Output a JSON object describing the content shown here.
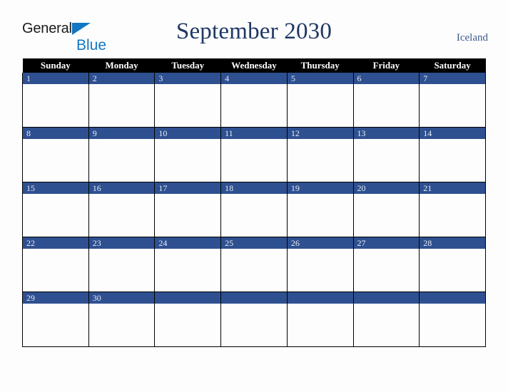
{
  "brand": {
    "line1": "General",
    "line2": "Blue",
    "triangle_icon": "triangle-icon",
    "color_dark": "#1a1a1a",
    "color_blue": "#1277c4"
  },
  "header": {
    "title": "September 2030",
    "country": "Iceland",
    "title_color": "#1f3864",
    "country_color": "#3d5a8a"
  },
  "calendar": {
    "weekday_headers": [
      "Sunday",
      "Monday",
      "Tuesday",
      "Wednesday",
      "Thursday",
      "Friday",
      "Saturday"
    ],
    "header_background": "#000000",
    "header_text_color": "#ffffff",
    "date_bar_color": "#2e5090",
    "date_text_color": "#e8ecf5",
    "cell_background": "#fdfdfd",
    "grid_line_color": "#000000",
    "weeks": [
      {
        "days": [
          {
            "date": "1"
          },
          {
            "date": "2"
          },
          {
            "date": "3"
          },
          {
            "date": "4"
          },
          {
            "date": "5"
          },
          {
            "date": "6"
          },
          {
            "date": "7"
          }
        ]
      },
      {
        "days": [
          {
            "date": "8"
          },
          {
            "date": "9"
          },
          {
            "date": "10"
          },
          {
            "date": "11"
          },
          {
            "date": "12"
          },
          {
            "date": "13"
          },
          {
            "date": "14"
          }
        ]
      },
      {
        "days": [
          {
            "date": "15"
          },
          {
            "date": "16"
          },
          {
            "date": "17"
          },
          {
            "date": "18"
          },
          {
            "date": "19"
          },
          {
            "date": "20"
          },
          {
            "date": "21"
          }
        ]
      },
      {
        "days": [
          {
            "date": "22"
          },
          {
            "date": "23"
          },
          {
            "date": "24"
          },
          {
            "date": "25"
          },
          {
            "date": "26"
          },
          {
            "date": "27"
          },
          {
            "date": "28"
          }
        ]
      },
      {
        "days": [
          {
            "date": "29"
          },
          {
            "date": "30"
          },
          {
            "date": ""
          },
          {
            "date": ""
          },
          {
            "date": ""
          },
          {
            "date": ""
          },
          {
            "date": ""
          }
        ]
      }
    ]
  }
}
